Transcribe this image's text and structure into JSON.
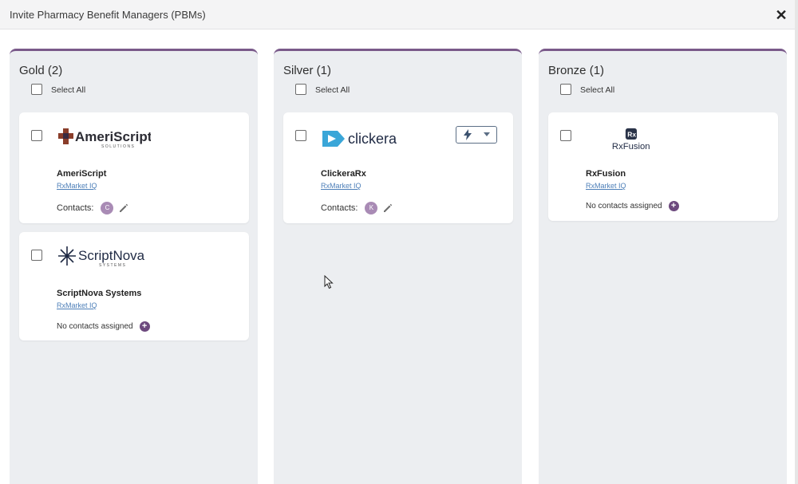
{
  "modal": {
    "title": "Invite Pharmacy Benefit Managers (PBMs)",
    "close_icon": "close-icon",
    "accent_color": "#7a5a8a"
  },
  "columns": [
    {
      "title": "Gold (2)",
      "select_all": "Select All",
      "cards": [
        {
          "logo_text": "AmeriScript",
          "logo_subtext": "SOLUTIONS",
          "name": "AmeriScript",
          "link": "RxMarket IQ",
          "contacts_label": "Contacts:",
          "avatar_initial": "C"
        },
        {
          "logo_text": "ScriptNova",
          "logo_subtext": "SYSTEMS",
          "name": "ScriptNova Systems",
          "link": "RxMarket IQ",
          "no_contacts": "No contacts assigned"
        }
      ]
    },
    {
      "title": "Silver (1)",
      "select_all": "Select All",
      "cards": [
        {
          "logo_text": "clickera",
          "name": "ClickeraRx",
          "link": "RxMarket IQ",
          "contacts_label": "Contacts:",
          "avatar_initial": "K",
          "action_icon": "lightning-bolt-icon"
        }
      ]
    },
    {
      "title": "Bronze (1)",
      "select_all": "Select All",
      "cards": [
        {
          "logo_text": "RxFusion",
          "logo_mark": "Rx",
          "name": "RxFusion",
          "link": "RxMarket IQ",
          "no_contacts": "No contacts assigned"
        }
      ]
    }
  ]
}
